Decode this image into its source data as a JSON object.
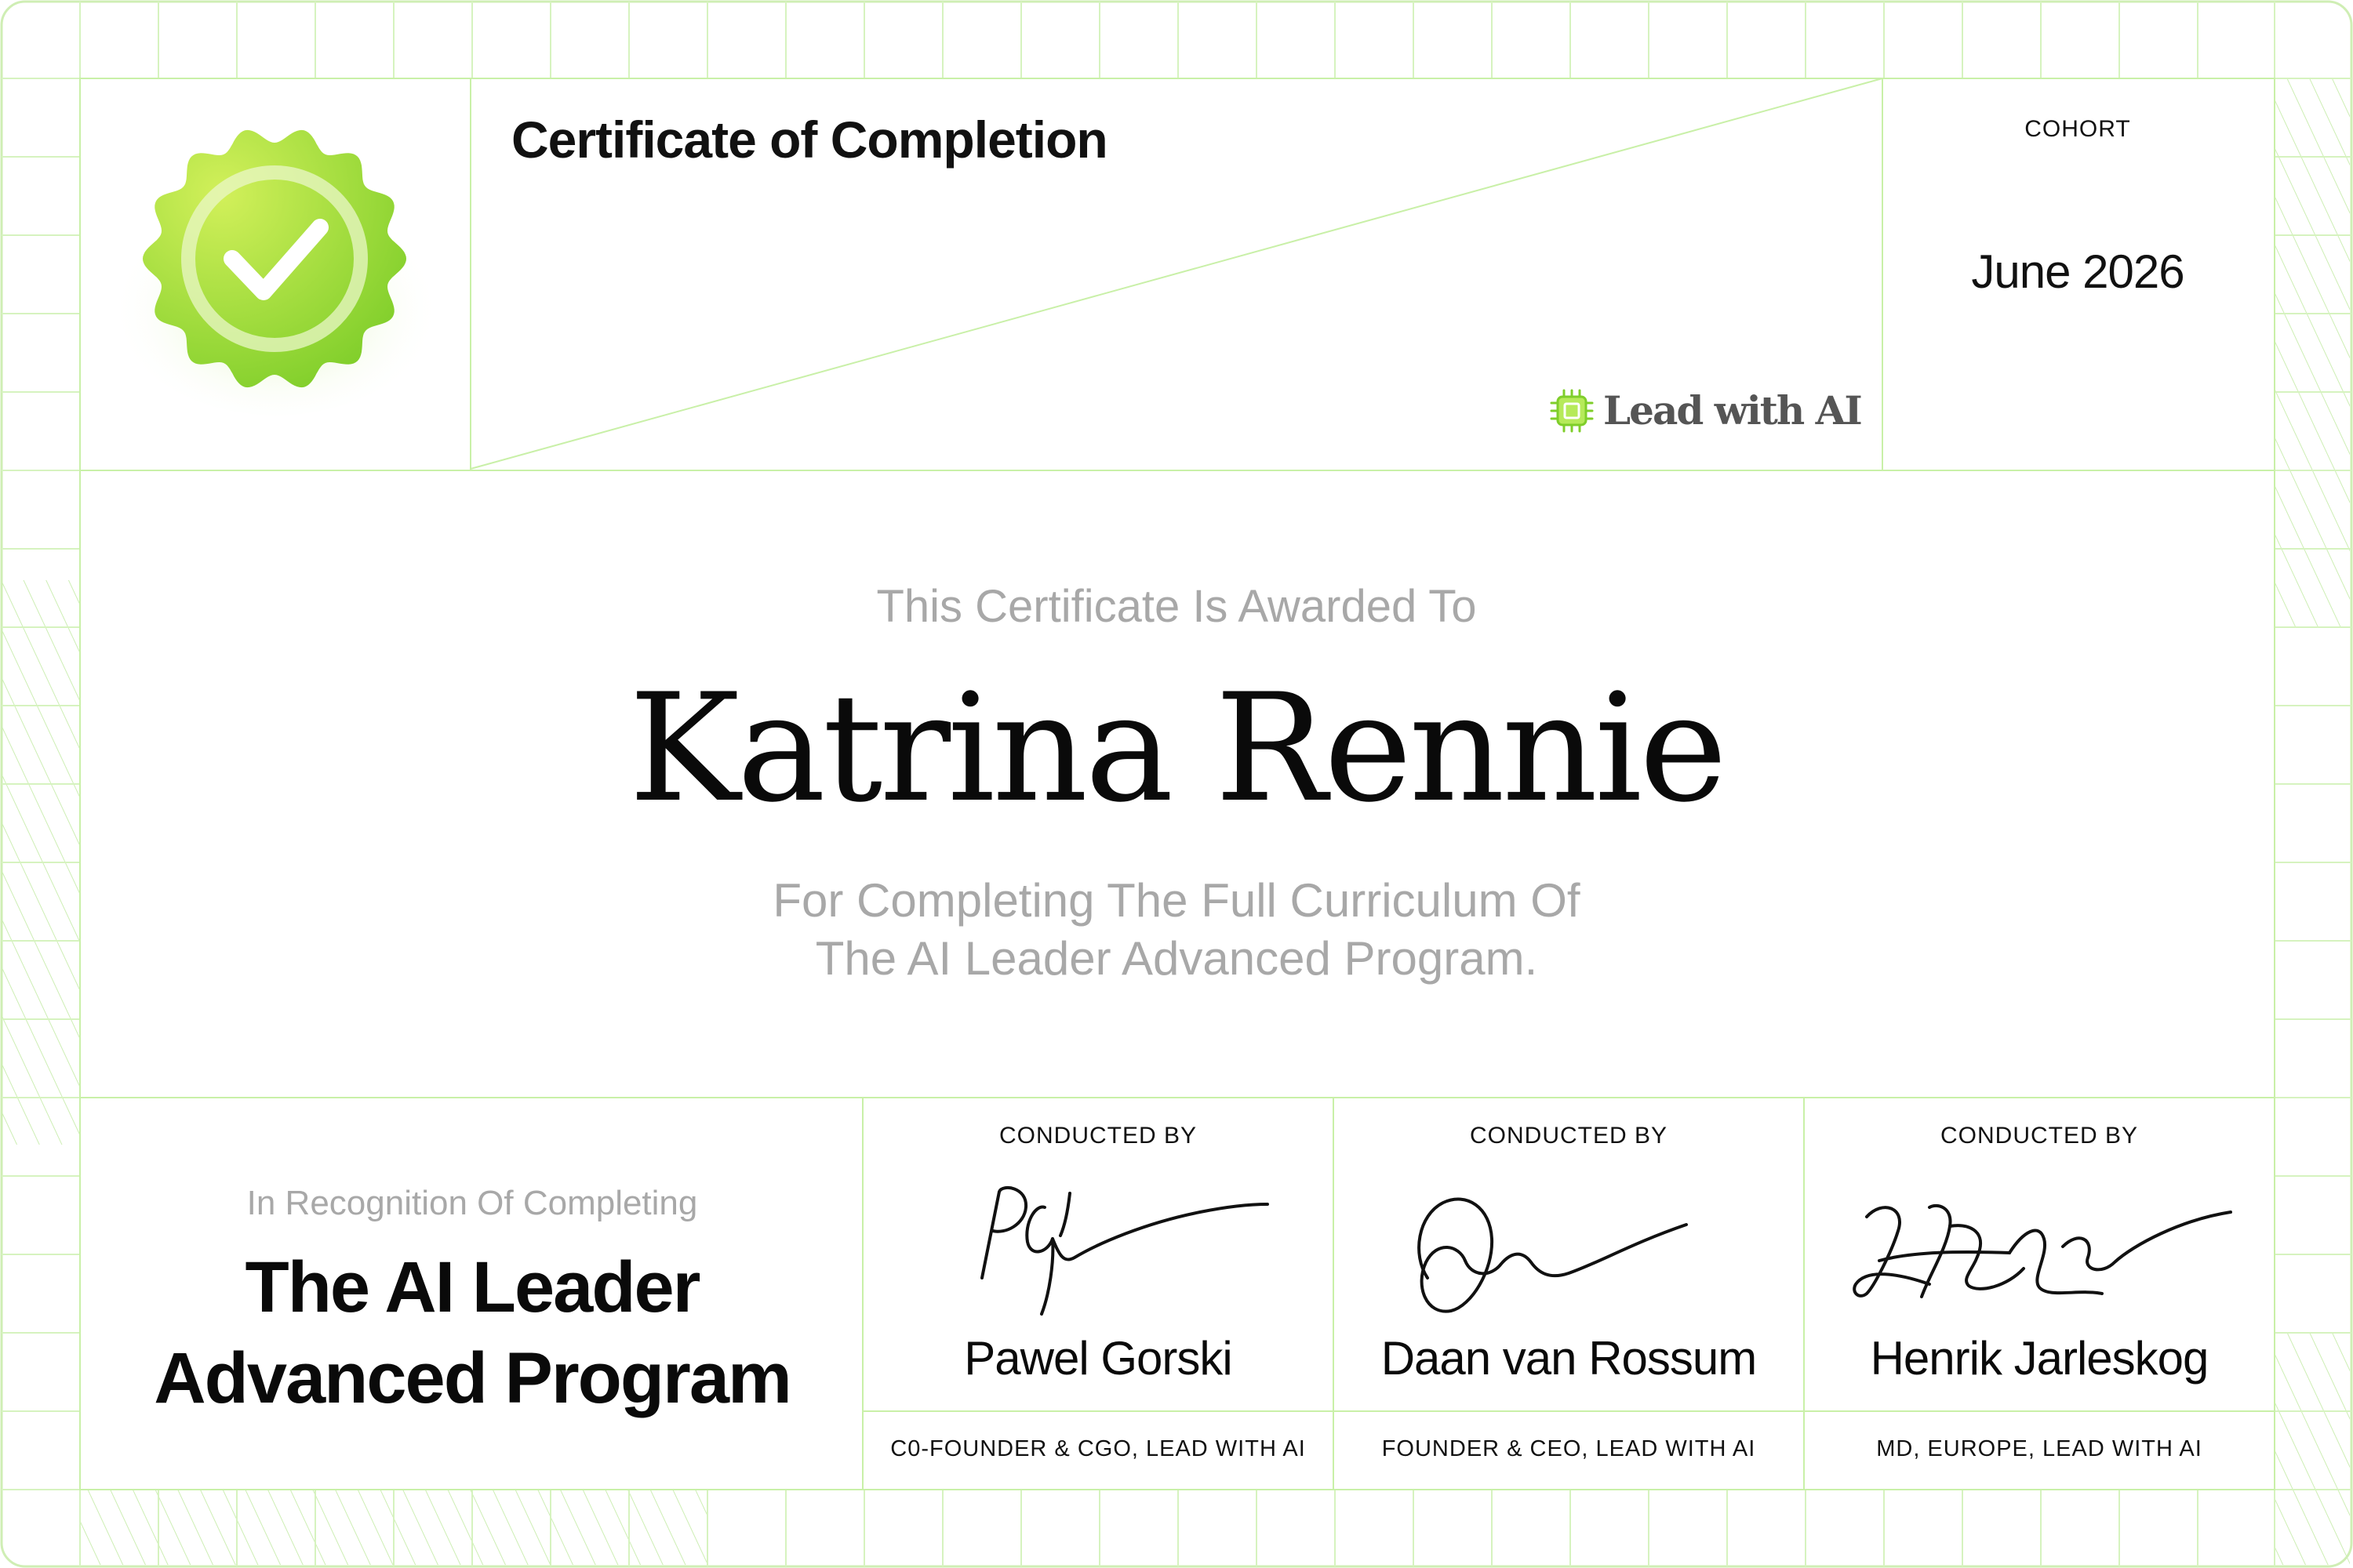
{
  "header": {
    "title": "Certificate of Completion",
    "cohort_label": "COHORT",
    "cohort_value": "June 2026",
    "logo_text": "Lead with AI"
  },
  "award": {
    "awarded_label": "This Certificate Is Awarded To",
    "recipient": "Katrina Rennie",
    "reason_line1": "For Completing The Full Curriculum Of",
    "reason_line2": "The AI Leader Advanced Program."
  },
  "recognition": {
    "label": "In Recognition Of Completing",
    "program_line1": "The AI Leader",
    "program_line2": "Advanced Program"
  },
  "signers": [
    {
      "conducted_label": "CONDUCTED BY",
      "name": "Pawel Gorski",
      "role": "C0-FOUNDER & CGO, LEAD WITH AI"
    },
    {
      "conducted_label": "CONDUCTED BY",
      "name": "Daan van Rossum",
      "role": "FOUNDER & CEO, LEAD WITH AI"
    },
    {
      "conducted_label": "CONDUCTED BY",
      "name": "Henrik Jarleskog",
      "role": "MD, EUROPE, LEAD WITH AI"
    }
  ],
  "colors": {
    "grid_line": "#c9f0a8",
    "badge_light": "#c3ec4e",
    "badge_dark": "#7fce2a",
    "muted_text": "#a8a8a8",
    "ink": "#0a0a0a"
  },
  "icons": [
    "verified-badge-icon",
    "chip-logo-icon"
  ]
}
